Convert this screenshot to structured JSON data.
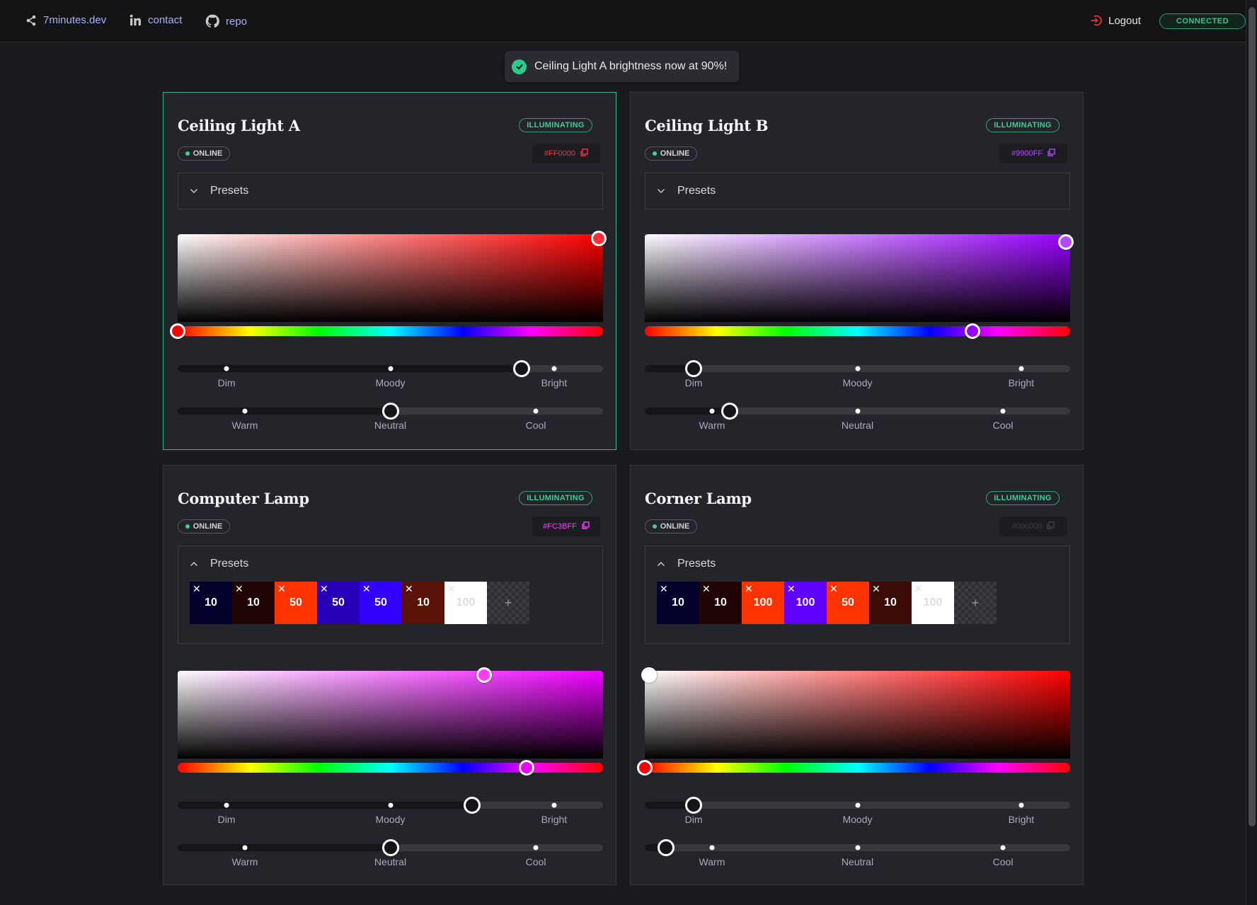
{
  "nav": {
    "site": "7minutes.dev",
    "contact": "contact",
    "repo": "repo",
    "logout": "Logout",
    "connection_status": "CONNECTED"
  },
  "toast": {
    "message": "Ceiling Light A brightness now at 90%!"
  },
  "status_label": "ILLUMINATING",
  "online_label": "ONLINE",
  "presets_label": "Presets",
  "brightness_labels": [
    "Dim",
    "Moody",
    "Bright"
  ],
  "temperature_labels": [
    "Warm",
    "Neutral",
    "Cool"
  ],
  "lights": [
    {
      "name": "Ceiling Light A",
      "hex": "#FF0000",
      "hex_color": "#ff2f3b",
      "hue_color": "#ff0000",
      "selected": true,
      "presets_open": false,
      "saturation": 0.99,
      "value": 0.95,
      "hue_fraction": 0.0,
      "brightness_percent": 90,
      "temperature_position": 0.5,
      "presets": []
    },
    {
      "name": "Ceiling Light B",
      "hex": "#9900FF",
      "hex_color": "#b14cff",
      "hue_color": "#9900ff",
      "selected": false,
      "presets_open": false,
      "saturation": 0.99,
      "value": 0.91,
      "hue_fraction": 0.77,
      "brightness_percent": 10,
      "temperature_position": 0.2,
      "presets": []
    },
    {
      "name": "Computer Lamp",
      "hex": "#FC3BFF",
      "hex_color": "#ff3bff",
      "hue_color": "#ee00ff",
      "selected": false,
      "presets_open": true,
      "saturation": 0.72,
      "value": 0.95,
      "hue_fraction": 0.82,
      "brightness_percent": 75,
      "temperature_position": 0.5,
      "presets": [
        {
          "value": "10",
          "color": "#03002b",
          "text_color": "#ffffff"
        },
        {
          "value": "10",
          "color": "#1f0503",
          "text_color": "#ffffff"
        },
        {
          "value": "50",
          "color": "#ff3300",
          "text_color": "#ffffff"
        },
        {
          "value": "50",
          "color": "#2800b8",
          "text_color": "#ffffff"
        },
        {
          "value": "50",
          "color": "#3300ff",
          "text_color": "#ffffff"
        },
        {
          "value": "10",
          "color": "#5a1208",
          "text_color": "#ffffff"
        },
        {
          "value": "100",
          "color": "#ffffff",
          "text_color": "#dddddd"
        }
      ]
    },
    {
      "name": "Corner Lamp",
      "hex": "#000000",
      "hex_color": "#3c3e44",
      "hue_color": "#ff0000",
      "selected": false,
      "presets_open": true,
      "saturation": 0.01,
      "value": 0.95,
      "hue_fraction": 0.0,
      "brightness_percent": 10,
      "temperature_position": 0.05,
      "presets": [
        {
          "value": "10",
          "color": "#03002b",
          "text_color": "#ffffff"
        },
        {
          "value": "10",
          "color": "#1f0503",
          "text_color": "#ffffff"
        },
        {
          "value": "100",
          "color": "#ff3300",
          "text_color": "#ffffff"
        },
        {
          "value": "100",
          "color": "#6000ff",
          "text_color": "#ffffff"
        },
        {
          "value": "50",
          "color": "#ff3300",
          "text_color": "#ffffff"
        },
        {
          "value": "10",
          "color": "#3a0c05",
          "text_color": "#ffffff"
        },
        {
          "value": "100",
          "color": "#ffffff",
          "text_color": "#dddddd"
        }
      ]
    }
  ]
}
